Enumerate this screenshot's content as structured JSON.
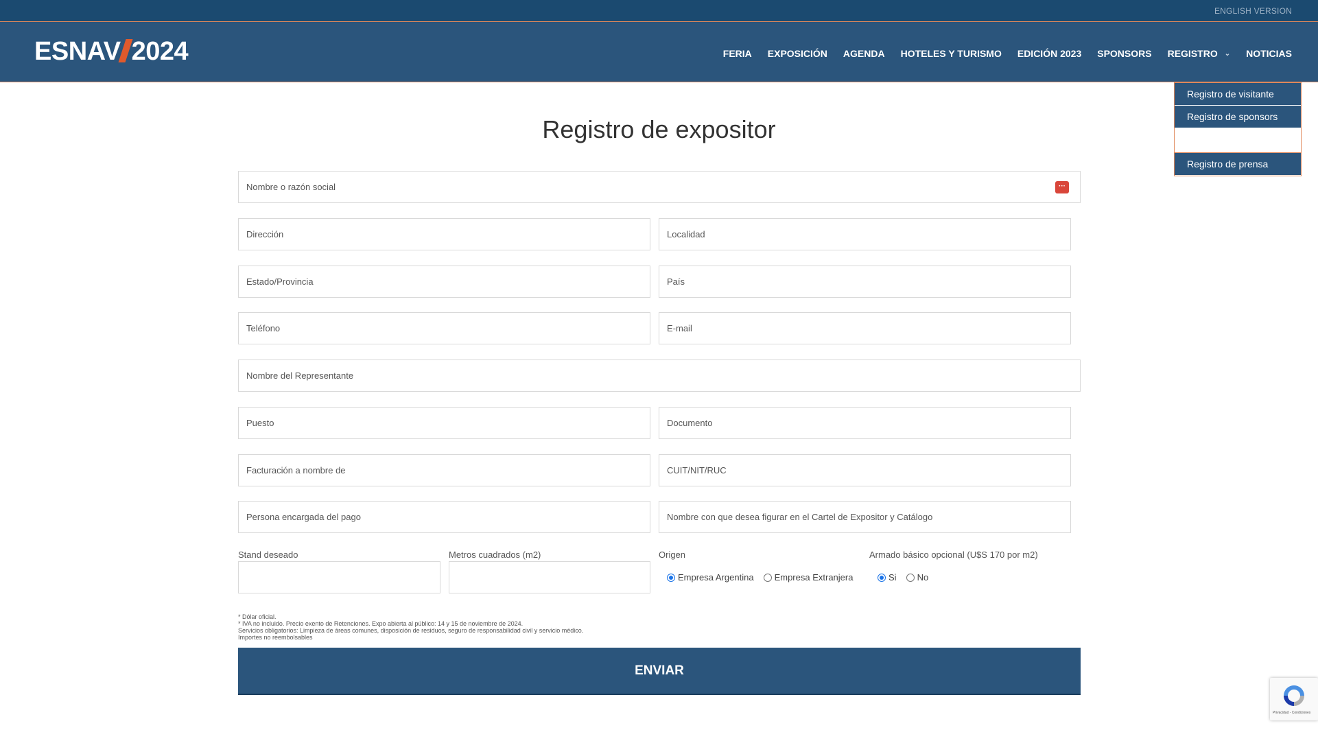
{
  "topbar": {
    "english": "ENGLISH VERSION"
  },
  "header": {
    "logo_left": "ESNAV",
    "logo_right": "2024",
    "nav": [
      "FERIA",
      "EXPOSICIÓN",
      "AGENDA",
      "HOTELES Y TURISMO",
      "EDICIÓN 2023",
      "SPONSORS",
      "REGISTRO",
      "NOTICIAS"
    ]
  },
  "dropdown": [
    "Registro de visitante",
    "Registro de sponsors",
    "",
    "Registro de prensa"
  ],
  "page": {
    "title": "Registro de expositor"
  },
  "form": {
    "name": "Nombre o razón social",
    "direccion": "Dirección",
    "localidad": "Localidad",
    "estado": "Estado/Provincia",
    "pais": "País",
    "telefono": "Teléfono",
    "email": "E-mail",
    "representante": "Nombre del Representante",
    "puesto": "Puesto",
    "documento": "Documento",
    "facturacion": "Facturación a nombre de",
    "cuit": "CUIT/NIT/RUC",
    "pago": "Persona encargada del pago",
    "cartel": "Nombre con que desea figurar en el Cartel de  Expositor y Catálogo",
    "stand_label": "Stand deseado",
    "metros_label": "Metros cuadrados (m2)",
    "origen_label": "Origen",
    "origen_opt1": "Empresa Argentina",
    "origen_opt2": "Empresa Extranjera",
    "armado_label": "Armado básico opcional (U$S 170 por m2)",
    "armado_si": "Si",
    "armado_no": "No"
  },
  "notes": [
    "* Dólar oficial.",
    "* IVA no incluido. Precio exento de Retenciones. Expo abierta al público: 14 y 15 de noviembre de 2024.",
    "Servicios obligatorios: Limpieza de áreas comunes, disposición de residuos, seguro de responsabilidad civil y servicio médico.",
    "Importes no reembolsables"
  ],
  "submit": "ENVIAR",
  "recaptcha": {
    "terms": "Privacidad - Condiciones"
  },
  "colors": {
    "navy": "#2b557c",
    "topbar": "#1b4a70",
    "accent": "#e05a2c"
  }
}
